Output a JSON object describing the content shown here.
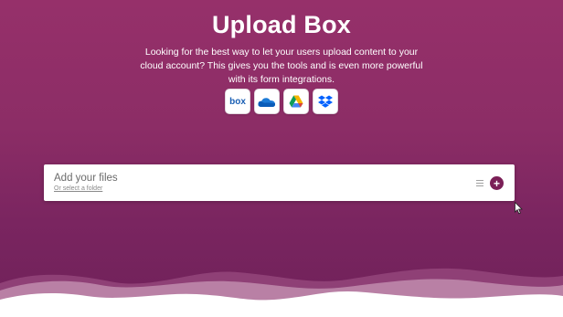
{
  "page": {
    "title": "Upload Box",
    "description": "Looking for the best way to let your users upload content to your cloud account? This gives you the tools and is even more powerful with its form integrations."
  },
  "providers": [
    {
      "name": "box",
      "label": "box",
      "icon": "box-icon"
    },
    {
      "name": "onedrive",
      "icon": "onedrive-icon"
    },
    {
      "name": "google-drive",
      "icon": "google-drive-icon"
    },
    {
      "name": "dropbox",
      "icon": "dropbox-icon"
    }
  ],
  "uploader": {
    "add_files_label": "Add your files",
    "select_folder_label": "Or select a folder",
    "list_icon": "list-icon",
    "add_icon": "plus-icon",
    "add_symbol": "+"
  },
  "colors": {
    "accent": "#7b1f57",
    "background_top": "#96306a",
    "background_bottom": "#6f2159"
  }
}
